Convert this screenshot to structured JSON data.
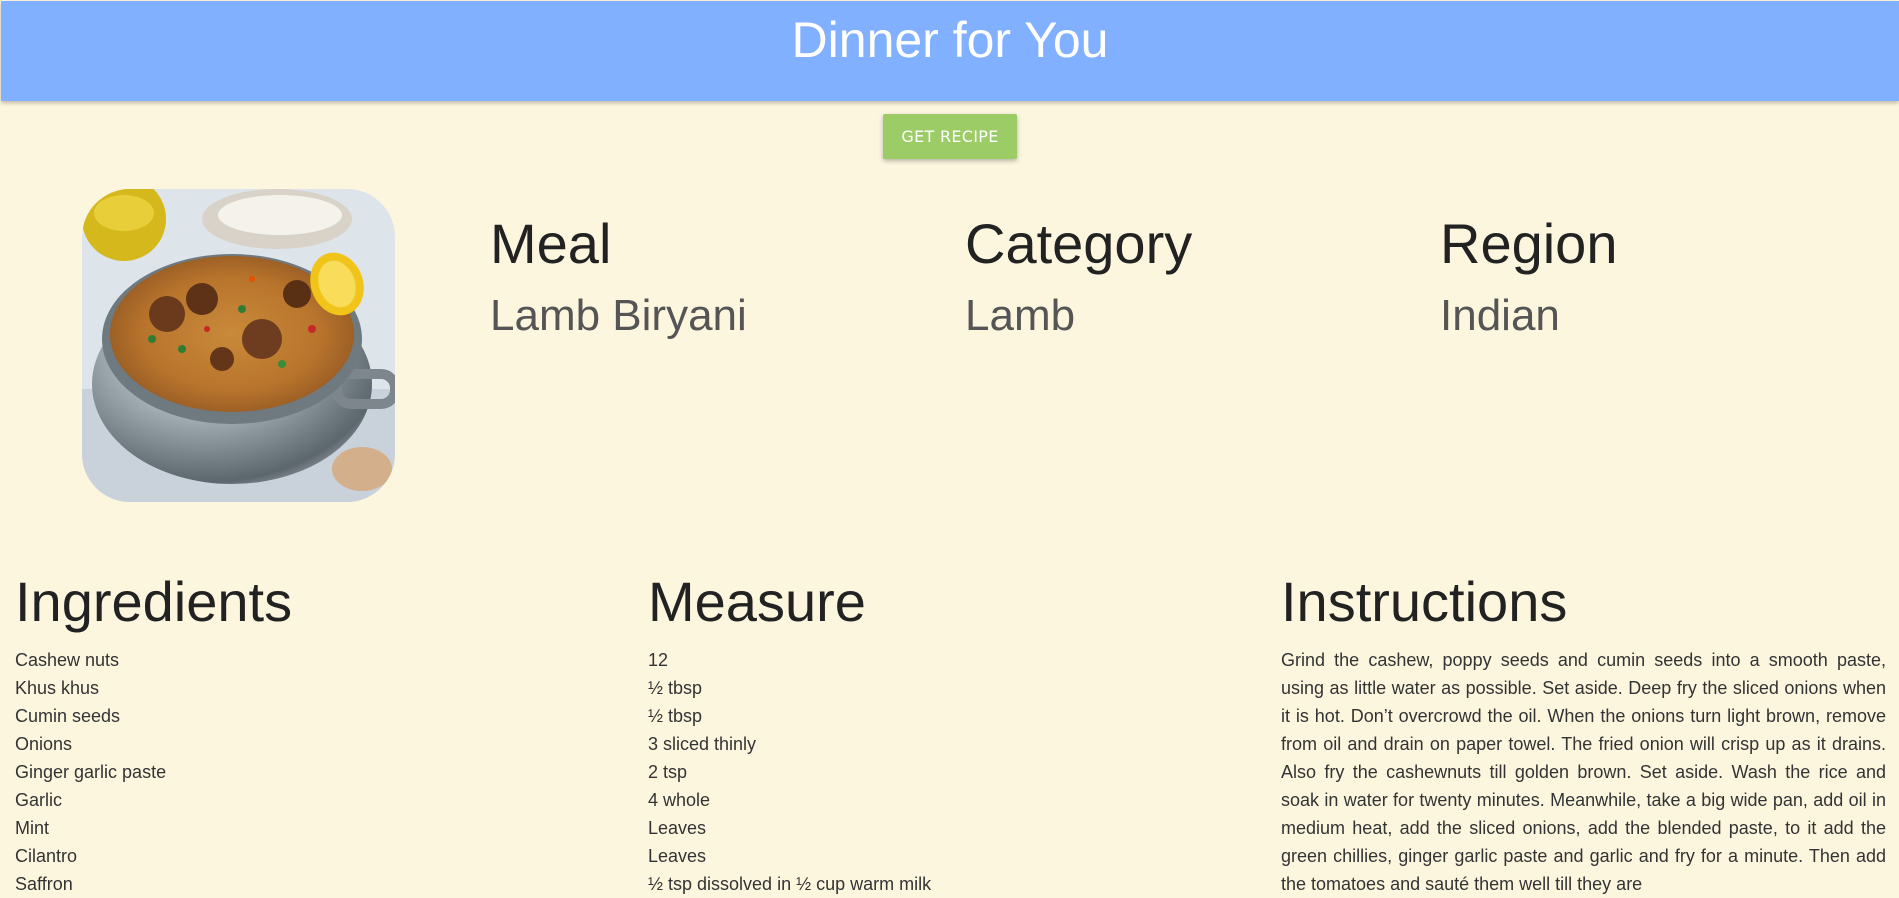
{
  "header": {
    "title": "Dinner for You"
  },
  "action": {
    "get_recipe_label": "GET RECIPE"
  },
  "meal": {
    "meal_heading": "Meal",
    "meal_value": "Lamb Biryani",
    "category_heading": "Category",
    "category_value": "Lamb",
    "region_heading": "Region",
    "region_value": "Indian"
  },
  "ingredients": {
    "heading": "Ingredients",
    "items": [
      "Cashew nuts",
      "Khus khus",
      "Cumin seeds",
      "Onions",
      "Ginger garlic paste",
      "Garlic",
      "Mint",
      "Cilantro",
      "Saffron"
    ]
  },
  "measure": {
    "heading": "Measure",
    "items": [
      "12",
      "½ tbsp",
      "½ tbsp",
      "3 sliced thinly",
      "2 tsp",
      "4 whole",
      "Leaves",
      "Leaves",
      "½ tsp dissolved in ½ cup warm milk"
    ]
  },
  "instructions": {
    "heading": "Instructions",
    "text": "Grind the cashew, poppy seeds and cumin seeds into a smooth paste, using as little water as possible. Set aside. Deep fry the sliced onions when it is hot. Don’t overcrowd the oil. When the onions turn light brown, remove from oil and drain on paper towel. The fried onion will crisp up as it drains. Also fry the cashewnuts till golden brown. Set aside. Wash the rice and soak in water for twenty minutes. Meanwhile, take a big wide pan, add oil in medium heat, add the sliced onions, add the blended paste, to it add the green chillies, ginger garlic paste and garlic and fry for a minute. Then add the tomatoes and sauté them well till they are"
  },
  "colors": {
    "header_bg": "#80b0ff",
    "page_bg": "#fdf6df",
    "button_bg": "#9ccc65"
  }
}
